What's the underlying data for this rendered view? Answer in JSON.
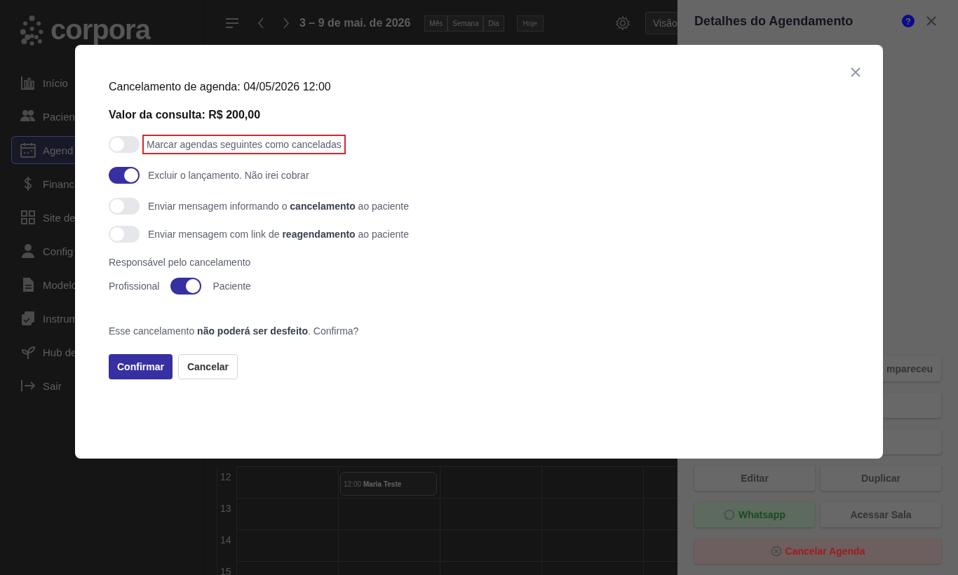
{
  "sidebar": {
    "logo": "corpora",
    "items": [
      {
        "label": "Início",
        "selected": false
      },
      {
        "label": "Pacien",
        "selected": false
      },
      {
        "label": "Agend",
        "selected": true
      },
      {
        "label": "Financ",
        "selected": false
      },
      {
        "label": "Site de",
        "selected": false
      },
      {
        "label": "Config",
        "selected": false
      },
      {
        "label": "Modelo",
        "selected": false
      },
      {
        "label": "Instrum",
        "selected": false
      },
      {
        "label": "Hub de",
        "selected": false
      },
      {
        "label": "Sair",
        "selected": false
      }
    ]
  },
  "topbar": {
    "range": "3 – 9 de mai. de 2026",
    "views": [
      "Mês",
      "Semana",
      "Dia"
    ],
    "today": "Hoje",
    "view_button": "Visão"
  },
  "calendar": {
    "rows": [
      {
        "hour": "12",
        "event": {
          "time": "12:00",
          "title": "Maria Teste"
        }
      },
      {
        "hour": "13"
      },
      {
        "hour": "14"
      },
      {
        "hour": "15"
      }
    ]
  },
  "drawer": {
    "title": "Detalhes do Agendamento",
    "help": "?",
    "actions": [
      {
        "kind": "partial",
        "label": "mpareceu"
      },
      {
        "kind": "blank"
      },
      {
        "kind": "blank"
      },
      {
        "kind": "plain",
        "label": "Editar"
      },
      {
        "kind": "plain",
        "label": "Duplicar"
      },
      {
        "kind": "whatsapp",
        "label": "Whatsapp"
      },
      {
        "kind": "plain",
        "label": "Acessar Sala"
      },
      {
        "kind": "danger",
        "label": "Cancelar Agenda"
      }
    ]
  },
  "modal": {
    "title": "Cancelamento de agenda: 04/05/2026 12:00",
    "price": "Valor da consulta: R$ 200,00",
    "option_groups": [
      [
        {
          "label": "Marcar agendas seguintes como canceladas",
          "on": false,
          "highlighted": true
        }
      ],
      [
        {
          "label": "Excluir o lançamento. Não irei cobrar",
          "on": true,
          "highlighted": false
        }
      ],
      [
        {
          "label": "Enviar mensagem informando o **cancelamento** ao paciente",
          "on": false,
          "highlighted": false
        },
        {
          "label": "Enviar mensagem com link de **reagendamento** ao paciente",
          "on": false,
          "highlighted": false
        }
      ]
    ],
    "responsible": {
      "label": "Responsável pelo cancelamento",
      "left": "Profissional",
      "right": "Paciente",
      "on": true
    },
    "warning": "Esse cancelamento **não poderá ser desfeito**. Confirma?",
    "buttons": [
      {
        "kind": "primary",
        "label": "Confirmar"
      },
      {
        "kind": "secondary",
        "label": "Cancelar"
      }
    ]
  }
}
